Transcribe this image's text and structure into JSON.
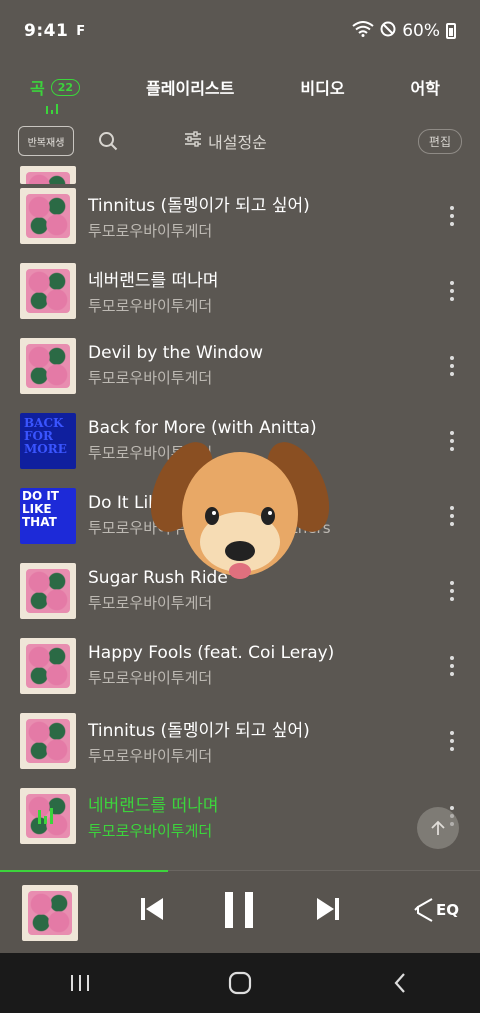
{
  "status_bar": {
    "time": "9:41",
    "carrier_glyph": "F",
    "battery": "60%"
  },
  "tabs": [
    {
      "label": "곡",
      "badge": "22",
      "active": true
    },
    {
      "label": "플레이리스트"
    },
    {
      "label": "비디오"
    },
    {
      "label": "어학"
    }
  ],
  "toolbar": {
    "repeat_label": "반복재생",
    "sort_label": "내설정순",
    "edit_label": "편집"
  },
  "tracks": [
    {
      "title": "Tinnitus (돌멩이가 되고 싶어)",
      "artist": "투모로우바이투게더",
      "art": "x"
    },
    {
      "title": "네버랜드를 떠나며",
      "artist": "투모로우바이투게더",
      "art": "x"
    },
    {
      "title": "Devil by the Window",
      "artist": "투모로우바이투게더",
      "art": "x"
    },
    {
      "title": "Back for More (with Anitta)",
      "artist": "투모로우바이투게더",
      "art": "back"
    },
    {
      "title": "Do It Like That",
      "artist": "투모로우바이투게더, Jonas Brothers",
      "art": "doit"
    },
    {
      "title": "Sugar Rush Ride",
      "artist": "투모로우바이투게더",
      "art": "x"
    },
    {
      "title": "Happy Fools (feat. Coi Leray)",
      "artist": "투모로우바이투게더",
      "art": "x"
    },
    {
      "title": "Tinnitus (돌멩이가 되고 싶어)",
      "artist": "투모로우바이투게더",
      "art": "x"
    },
    {
      "title": "네버랜드를 떠나며",
      "artist": "투모로우바이투게더",
      "art": "x",
      "playing": true
    }
  ],
  "player": {
    "eq_label": "EQ",
    "progress": 0.35
  },
  "colors": {
    "accent": "#3cd43c",
    "background": "#5b5752",
    "navbar": "#1a1a1a"
  }
}
